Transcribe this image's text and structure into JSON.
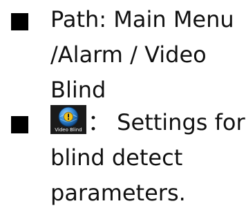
{
  "items": [
    {
      "lines": [
        "Path: Main Menu",
        "/Alarm / Video",
        "Blind"
      ]
    },
    {
      "icon_name": "video-blind-icon",
      "icon_label": "Video Blind",
      "lines": [
        "： Settings for",
        "blind detect",
        "parameters."
      ]
    }
  ],
  "colors": {
    "icon_globe": "#2e86d4",
    "icon_badge": "#f2c21b"
  }
}
